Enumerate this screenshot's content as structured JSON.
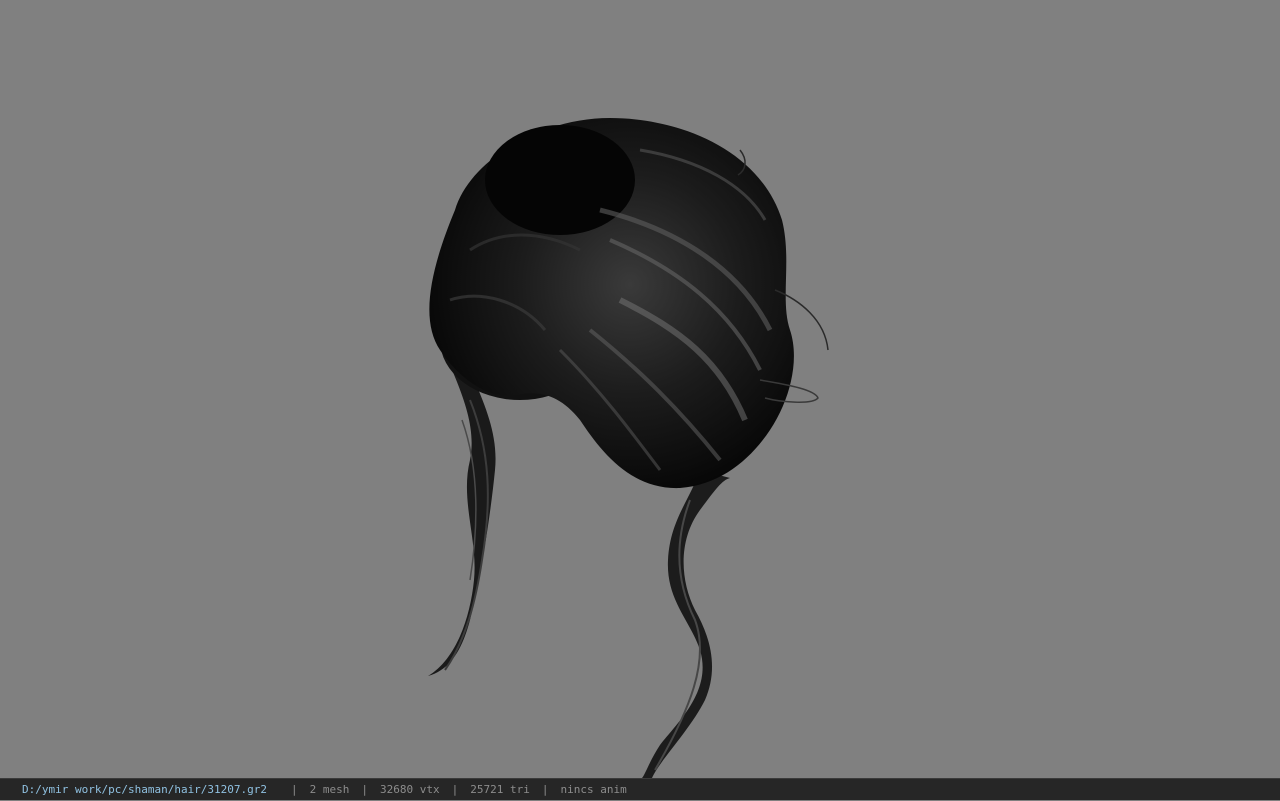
{
  "viewport": {
    "background_color": "#808080",
    "model": "hair-mesh"
  },
  "status_bar": {
    "file_path": "D:/ymir work/pc/shaman/hair/31207.gr2",
    "separator": "|",
    "mesh_count": "2 mesh",
    "vertex_count": "32680 vtx",
    "triangle_count": "25721 tri",
    "anim_status": "nincs anim",
    "path_color": "#8fc0e0",
    "text_color": "#8c8c8c",
    "background_color": "#262626"
  }
}
